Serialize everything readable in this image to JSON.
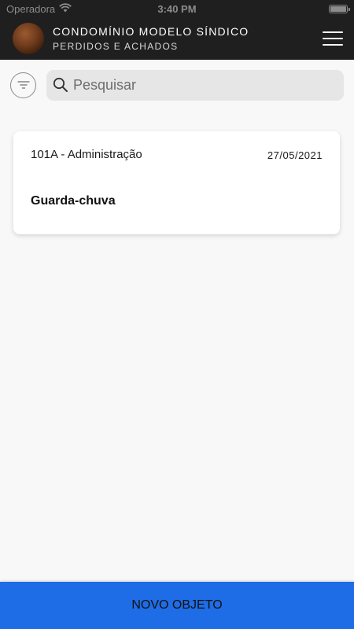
{
  "status_bar": {
    "carrier": "Operadora",
    "time": "3:40 PM"
  },
  "header": {
    "title": "CONDOMÍNIO MODELO SÍNDICO",
    "subtitle": "PERDIDOS E ACHADOS"
  },
  "search": {
    "placeholder": "Pesquisar",
    "value": ""
  },
  "items": [
    {
      "unit": "101A - Administração",
      "date": "27/05/2021",
      "name": "Guarda-chuva"
    }
  ],
  "actions": {
    "new_object_label": "NOVO OBJETO"
  },
  "colors": {
    "header_bg": "#1f1f1f",
    "background": "#f8f8f8",
    "primary_button": "#1f6de6"
  },
  "icons": [
    "wifi-icon",
    "battery-icon",
    "menu-icon",
    "filter-icon",
    "search-icon"
  ]
}
